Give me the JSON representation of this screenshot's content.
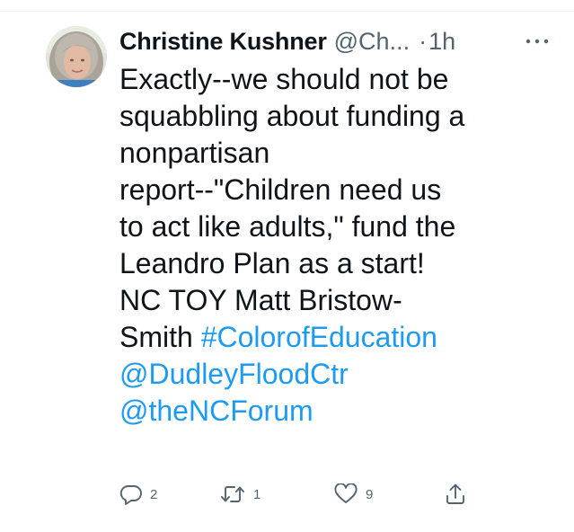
{
  "tweet": {
    "author": {
      "display_name": "Christine Kushner",
      "handle": "@Ch...",
      "avatar_icon": "avatar-photo"
    },
    "separator": "·",
    "time": "1h",
    "more_icon": "more-horizontal-icon",
    "text_lines": [
      "Exactly--we should not be",
      "squabbling about funding a",
      "nonpartisan",
      "report--\"Children need us",
      "to act like adults,\" fund the",
      "Leandro Plan as a start!",
      "NC TOY Matt Bristow-"
    ],
    "last_line_prefix": "Smith ",
    "hashtag": "#ColorofEducation",
    "mentions": [
      "@DudleyFloodCtr",
      "@theNCForum"
    ],
    "actions": {
      "reply_count": "2",
      "retweet_count": "1",
      "like_count": "9"
    },
    "colors": {
      "text": "#0f1419",
      "secondary": "#536471",
      "link": "#1d9bf0",
      "divider": "#eff3f4"
    }
  }
}
